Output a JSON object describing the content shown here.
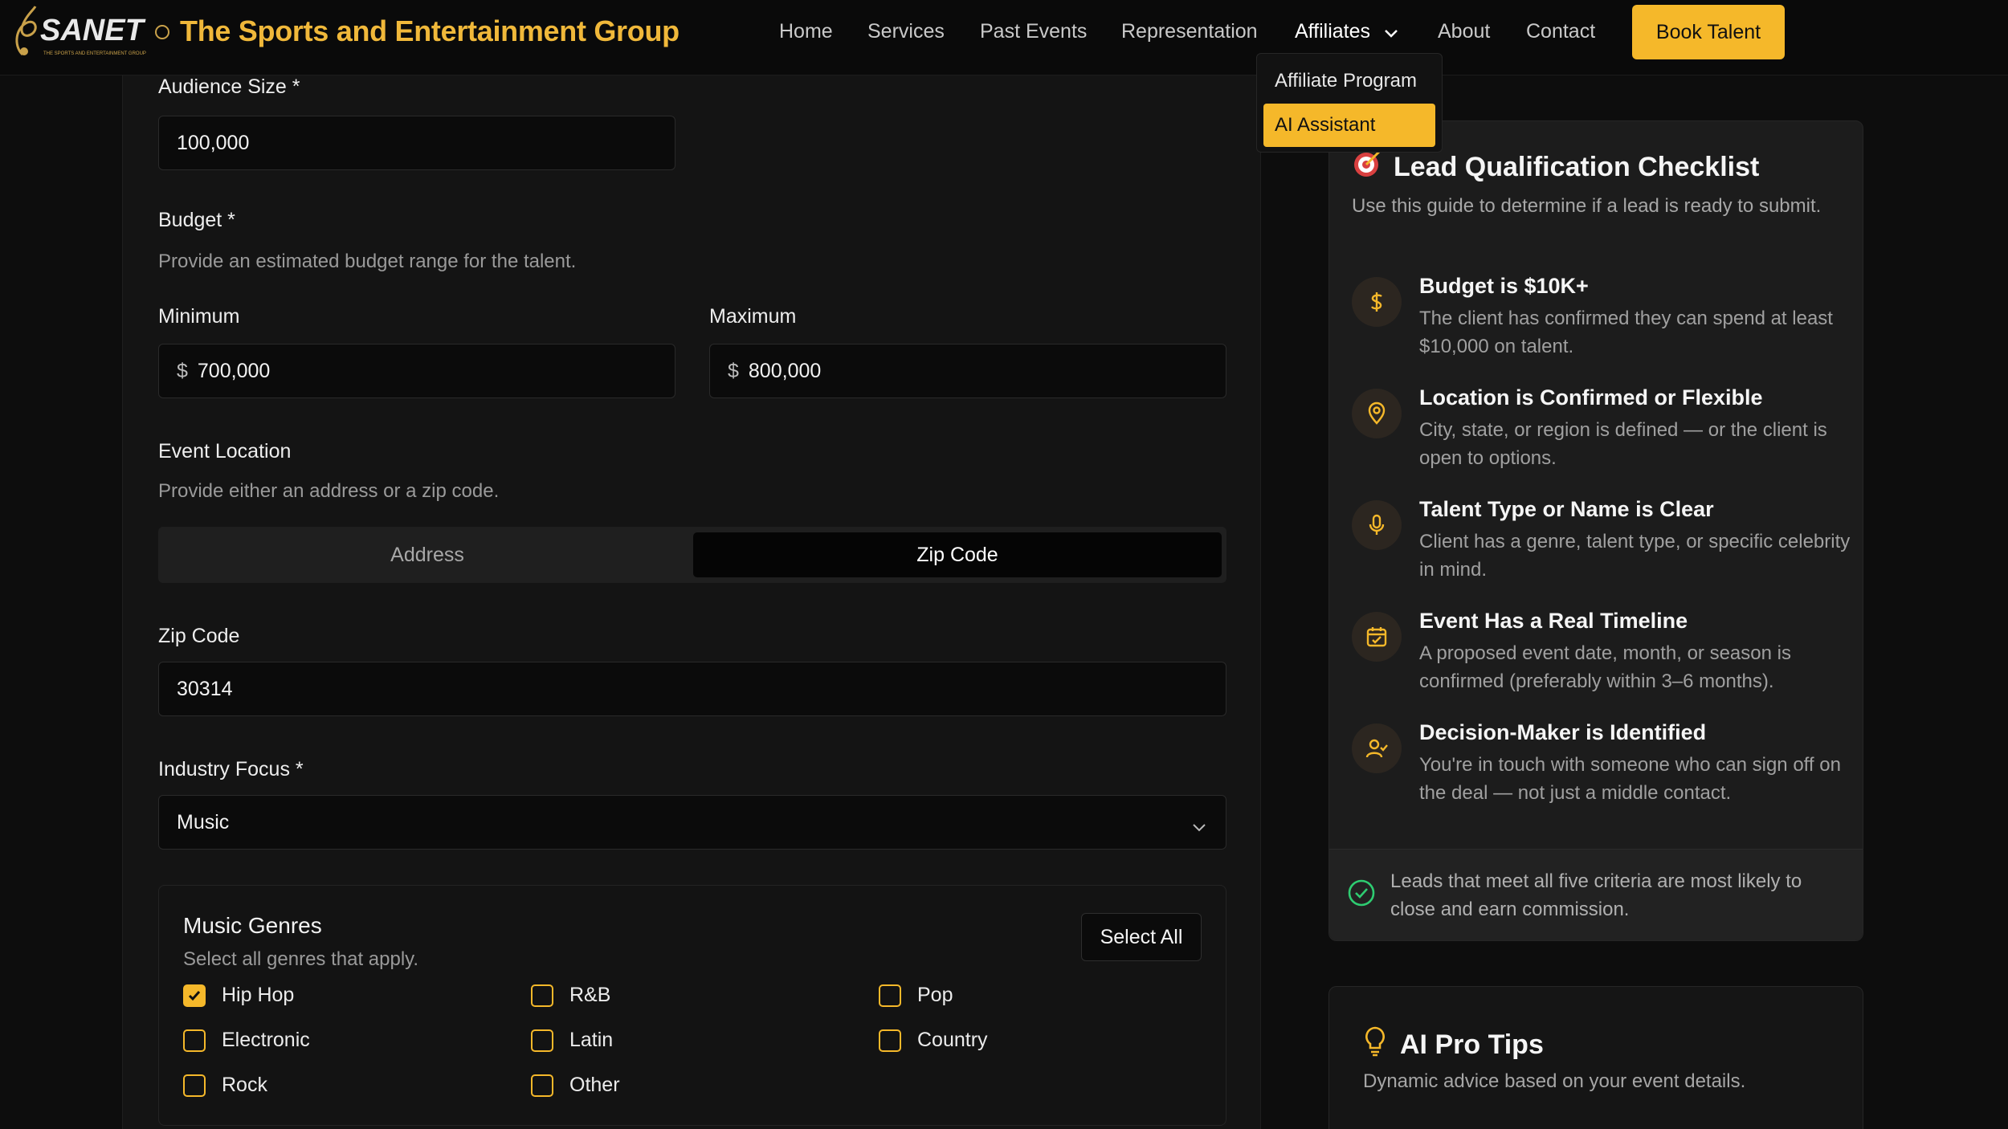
{
  "header": {
    "logo_text": "SANET",
    "logo_tagline": "THE SPORTS AND ENTERTAINMENT GROUP",
    "brand": "The Sports and Entertainment Group",
    "nav": {
      "home": "Home",
      "services": "Services",
      "past_events": "Past Events",
      "representation": "Representation",
      "affiliates": "Affiliates",
      "about": "About",
      "contact": "Contact"
    },
    "book_button": "Book Talent"
  },
  "dropdown": {
    "items": [
      "Affiliate Program",
      "AI Assistant"
    ],
    "highlighted": "AI Assistant"
  },
  "form": {
    "audience": {
      "label": "Audience Size *",
      "value": "100,000"
    },
    "budget": {
      "label": "Budget *",
      "help": "Provide an estimated budget range for the talent.",
      "min_label": "Minimum",
      "min_value": "700,000",
      "max_label": "Maximum",
      "max_value": "800,000",
      "currency": "$"
    },
    "location": {
      "label": "Event Location",
      "help": "Provide either an address or a zip code.",
      "tabs": [
        "Address",
        "Zip Code"
      ],
      "active_tab": "Zip Code"
    },
    "zip": {
      "label": "Zip Code",
      "value": "30314"
    },
    "industry": {
      "label": "Industry Focus *",
      "value": "Music"
    },
    "genres": {
      "title": "Music Genres",
      "subtitle": "Select all genres that apply.",
      "select_all": "Select All",
      "options": [
        {
          "label": "Hip Hop",
          "checked": true
        },
        {
          "label": "R&B",
          "checked": false
        },
        {
          "label": "Pop",
          "checked": false
        },
        {
          "label": "Electronic",
          "checked": false
        },
        {
          "label": "Latin",
          "checked": false
        },
        {
          "label": "Country",
          "checked": false
        },
        {
          "label": "Rock",
          "checked": false
        },
        {
          "label": "Other",
          "checked": false
        }
      ]
    }
  },
  "checklist": {
    "title": "Lead Qualification Checklist",
    "intro": "Use this guide to determine if a lead is ready to submit.",
    "items": [
      {
        "icon": "dollar-icon",
        "title": "Budget is $10K+",
        "desc": "The client has confirmed they can spend at least $10,000 on talent."
      },
      {
        "icon": "map-pin-icon",
        "title": "Location is Confirmed or Flexible",
        "desc": "City, state, or region is defined — or the client is open to options."
      },
      {
        "icon": "microphone-icon",
        "title": "Talent Type or Name is Clear",
        "desc": "Client has a genre, talent type, or specific celebrity in mind."
      },
      {
        "icon": "calendar-check-icon",
        "title": "Event Has a Real Timeline",
        "desc": "A proposed event date, month, or season is confirmed (preferably within 3–6 months)."
      },
      {
        "icon": "user-check-icon",
        "title": "Decision-Maker is Identified",
        "desc": "You're in touch with someone who can sign off on the deal — not just a middle contact."
      }
    ],
    "footer": "Leads that meet all five criteria are most likely to close and earn commission."
  },
  "tips": {
    "title": "AI Pro Tips",
    "subtitle": "Dynamic advice based on your event details."
  },
  "colors": {
    "accent": "#f5b82a",
    "brand_text": "#f0b83a",
    "success": "#2ecc71",
    "background": "#0d0d0d"
  }
}
